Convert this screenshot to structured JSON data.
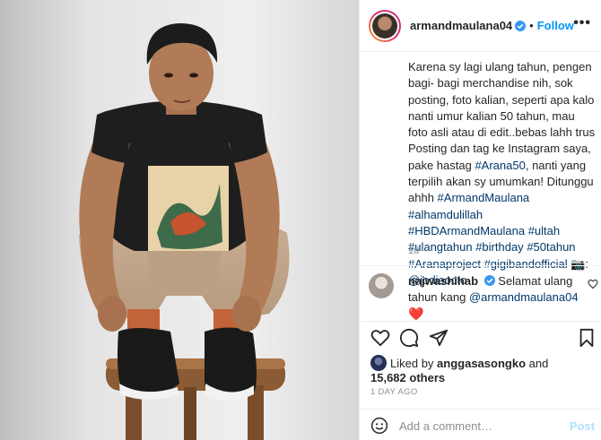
{
  "post": {
    "username": "armandmaulana04",
    "separator": "•",
    "follow_label": "Follow",
    "more_label": "•••",
    "caption_parts": [
      {
        "type": "text",
        "value": "Karena sy lagi ulang tahun, pengen bagi- bagi merchandise nih, sok posting, foto kalian, seperti apa kalo nanti umur kalian 50 tahun, mau foto asli atau di edit..bebas lahh trus Posting dan tag ke Instagram saya, pake hastag "
      },
      {
        "type": "link",
        "value": "#Arana50"
      },
      {
        "type": "text",
        "value": ", nanti yang terpilih akan sy umumkan! Ditunggu ahhh "
      },
      {
        "type": "link",
        "value": "#ArmandMaulana"
      },
      {
        "type": "text",
        "value": " "
      },
      {
        "type": "link",
        "value": "#alhamdulillah"
      },
      {
        "type": "text",
        "value": " "
      },
      {
        "type": "link",
        "value": "#HBDArmandMaulana"
      },
      {
        "type": "text",
        "value": " "
      },
      {
        "type": "link",
        "value": "#ultah"
      },
      {
        "type": "text",
        "value": " "
      },
      {
        "type": "link",
        "value": "#ulangtahun"
      },
      {
        "type": "text",
        "value": " "
      },
      {
        "type": "link",
        "value": "#birthday"
      },
      {
        "type": "text",
        "value": " "
      },
      {
        "type": "link",
        "value": "#50tahun"
      },
      {
        "type": "text",
        "value": " "
      },
      {
        "type": "link",
        "value": "#Aranaproject"
      },
      {
        "type": "text",
        "value": " "
      },
      {
        "type": "link",
        "value": "#gigibandofficial"
      },
      {
        "type": "text",
        "value": " 📷: "
      },
      {
        "type": "link",
        "value": "@jodieocto"
      }
    ],
    "caption_age": "1d"
  },
  "comment": {
    "username": "najwashihab",
    "text": " Selamat ulang tahun kang ",
    "mention": "@armandmaulana04",
    "emoji": "❤️"
  },
  "likes": {
    "prefix": "Liked by ",
    "user": "anggasasongko",
    "middle": " and",
    "count_text": "15,682 others"
  },
  "date_label": "1 DAY AGO",
  "add_comment": {
    "placeholder": "Add a comment…",
    "post_label": "Post"
  },
  "icons": {
    "verified": "verified-badge-icon",
    "like": "heart-outline-icon",
    "comment": "speech-bubble-icon",
    "share": "paper-plane-icon",
    "save": "bookmark-icon",
    "emoji": "smiley-icon"
  },
  "colors": {
    "link": "#00376b",
    "follow": "#0095f6",
    "verified": "#3897f0",
    "muted": "#8e8e8e"
  }
}
